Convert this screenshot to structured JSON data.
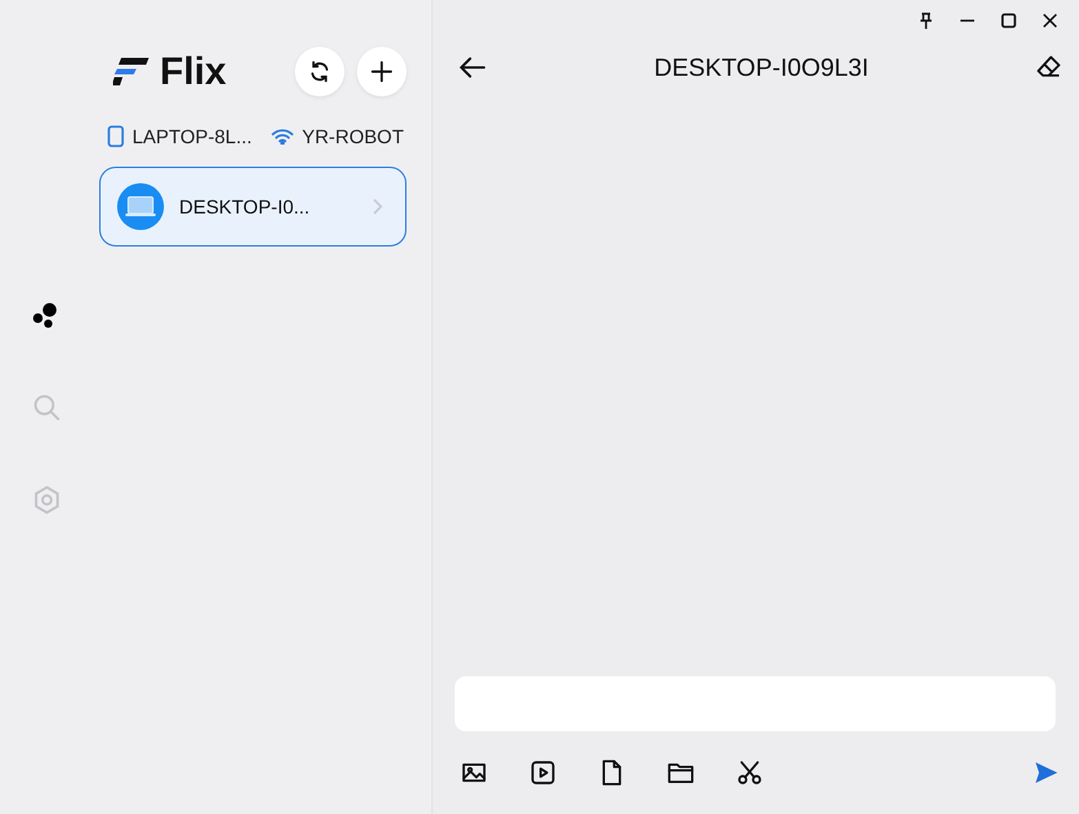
{
  "app": {
    "name": "Flix"
  },
  "nav": [
    {
      "kind": "peers",
      "selected": true
    },
    {
      "kind": "search",
      "selected": false
    },
    {
      "kind": "settings",
      "selected": false
    }
  ],
  "info": [
    {
      "kind": "device",
      "label": "LAPTOP-8L..."
    },
    {
      "kind": "wifi",
      "label": "YR-ROBOT"
    }
  ],
  "devices": [
    {
      "name": "DESKTOP-I0...",
      "selected": true
    }
  ],
  "chat": {
    "title": "DESKTOP-I0O9L3I"
  },
  "toolbar": [
    {
      "kind": "image"
    },
    {
      "kind": "video"
    },
    {
      "kind": "file"
    },
    {
      "kind": "folder"
    },
    {
      "kind": "cut"
    },
    {
      "kind": "send"
    }
  ]
}
